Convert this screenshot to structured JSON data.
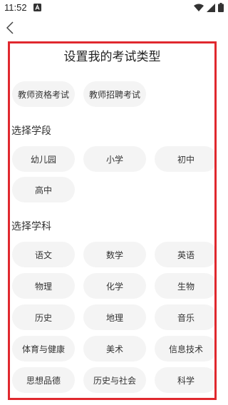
{
  "status_bar": {
    "time": "11:52",
    "notification_icon": "a-icon",
    "icons": [
      "wifi-icon",
      "signal-icon",
      "battery-icon"
    ]
  },
  "header": {
    "back_icon": "chevron-left-icon"
  },
  "page_title": "设置我的考试类型",
  "exam_types": [
    "教师资格考试",
    "教师招聘考试"
  ],
  "stage_label": "选择学段",
  "stages": [
    "幼儿园",
    "小学",
    "初中",
    "高中"
  ],
  "subject_label": "选择学科",
  "subjects": [
    "语文",
    "数学",
    "英语",
    "物理",
    "化学",
    "生物",
    "历史",
    "地理",
    "音乐",
    "体育与健康",
    "美术",
    "信息技术",
    "思想品德",
    "历史与社会",
    "科学"
  ],
  "colors": {
    "highlight_border": "#e0282e",
    "pill_background": "#f4f4f4"
  }
}
